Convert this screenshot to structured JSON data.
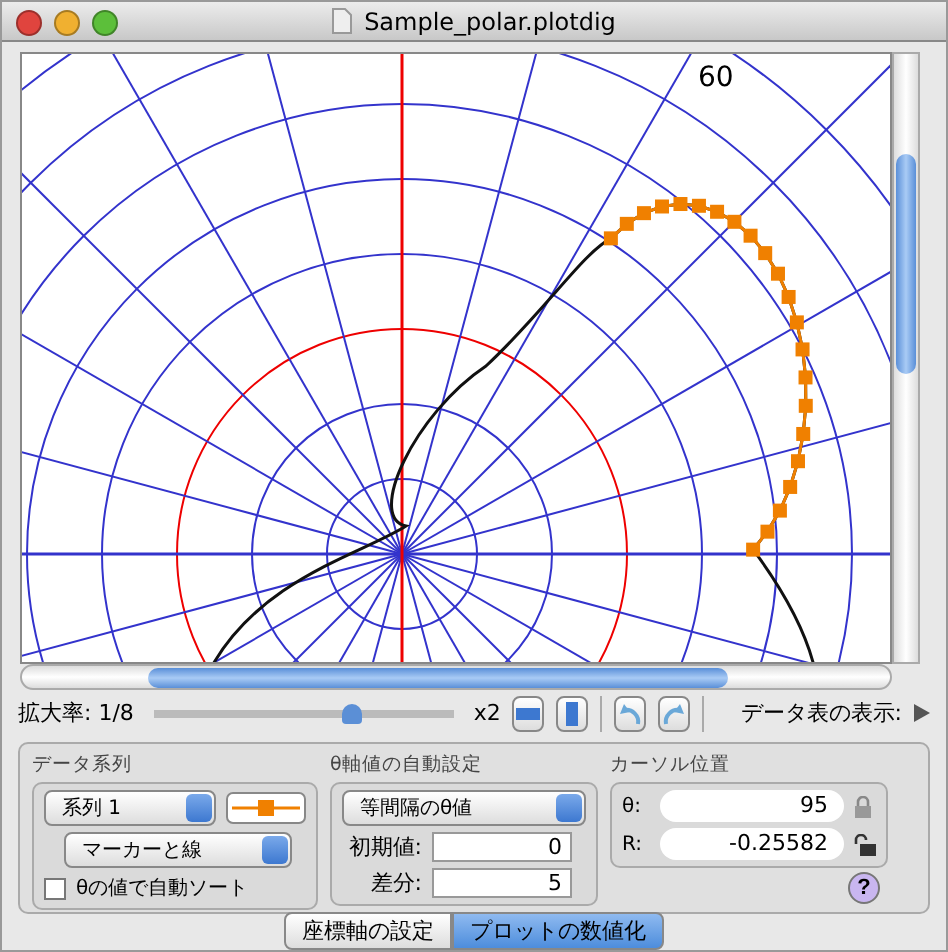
{
  "window": {
    "title": "Sample_polar.plotdig"
  },
  "plot": {
    "value_label": "60"
  },
  "zoom": {
    "label": "拡大率: 1/8",
    "level": 0.66,
    "max_label": "x2"
  },
  "data_table": {
    "label": "データ表の表示:"
  },
  "data_series": {
    "title": "データ系列",
    "series_select": "系列 1",
    "style_select": "マーカーと線",
    "auto_sort": {
      "label": "θの値で自動ソート",
      "checked": false
    }
  },
  "theta_auto": {
    "title": "θ軸値の自動設定",
    "mode_select": "等間隔のθ値",
    "fields": [
      {
        "label": "初期値:",
        "value": "0"
      },
      {
        "label": "差分:",
        "value": "5"
      }
    ]
  },
  "cursor": {
    "title": "カーソル位置",
    "fields": [
      {
        "label": "θ:",
        "value": "95",
        "locked": true
      },
      {
        "label": "R:",
        "value": "-0.25582",
        "locked": false
      }
    ]
  },
  "help_button": "?",
  "tabs": [
    {
      "label": "座標軸の設定",
      "selected": false
    },
    {
      "label": "プロットの数値化",
      "selected": true
    }
  ]
}
